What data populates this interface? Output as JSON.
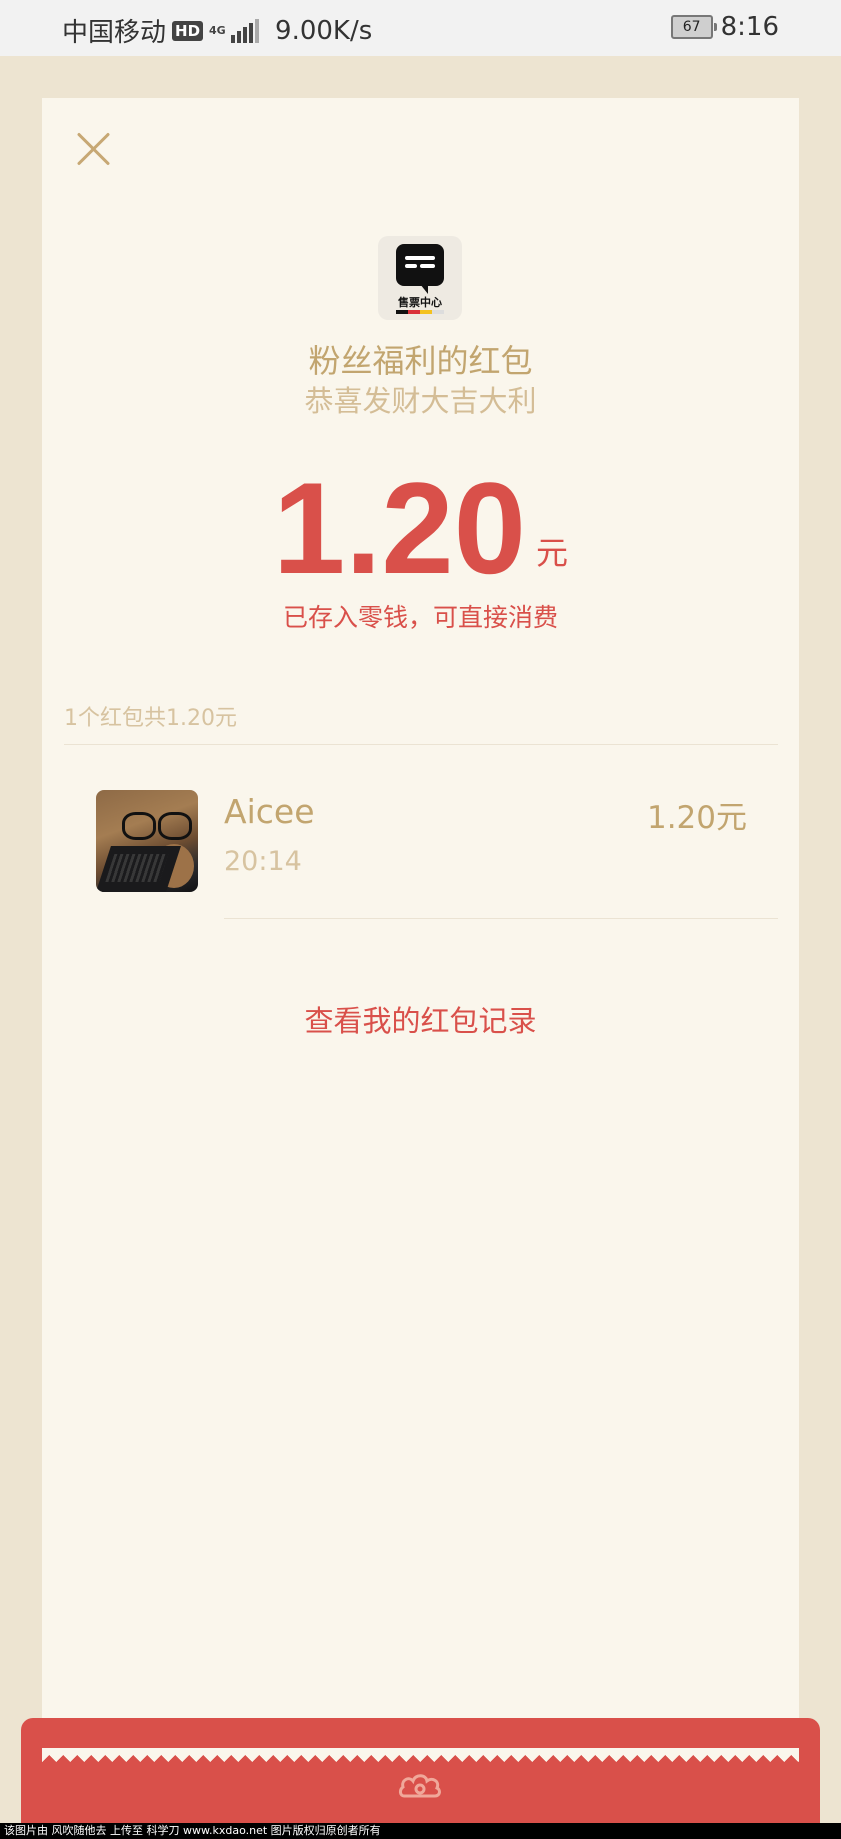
{
  "status_bar": {
    "carrier": "中国移动",
    "hd": "HD",
    "network": "4G",
    "speed": "9.00K/s",
    "battery": "67",
    "time": "8:16"
  },
  "card": {
    "logo_text": "售票中心",
    "title": "粉丝福利的红包",
    "subtitle": "恭喜发财大吉大利",
    "amount": "1.20",
    "amount_unit": "元",
    "amount_note": "已存入零钱，可直接消费",
    "summary": "1个红包共1.20元",
    "entries": [
      {
        "name": "Aicee",
        "time": "20:14",
        "amount": "1.20元"
      }
    ],
    "records_link": "查看我的红包记录"
  },
  "colors": {
    "accent_red": "#d9504a",
    "gold": "#c2a56f",
    "card_bg": "#faf6ec",
    "page_bg": "#ede4d1"
  },
  "watermark": "该图片由 风吹随他去 上传至 科学刀 www.kxdao.net 图片版权归原创者所有"
}
